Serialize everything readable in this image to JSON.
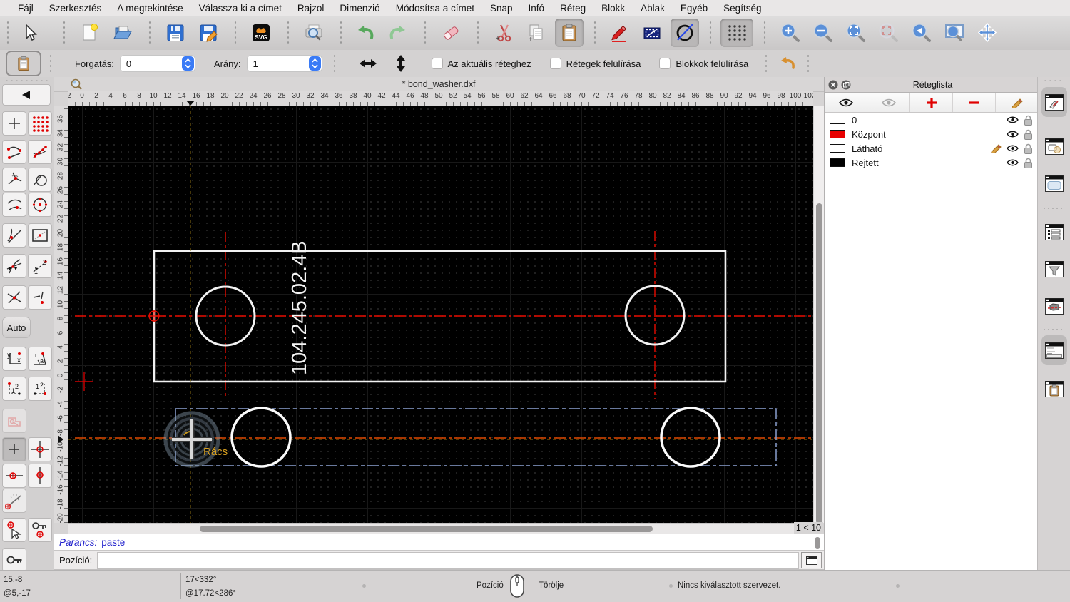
{
  "app": {
    "menu_items": [
      "Fájl",
      "Szerkesztés",
      "A megtekintése",
      "Válassza ki a címet",
      "Rajzol",
      "Dimenzió",
      "Módosítsa a címet",
      "Snap",
      "Infó",
      "Réteg",
      "Blokk",
      "Ablak",
      "Egyéb",
      "Segítség"
    ]
  },
  "main_toolbar": {
    "icons": [
      "cursor",
      "new-file",
      "open-file",
      "save",
      "save-as",
      "svg-export",
      "print-preview",
      "undo",
      "redo",
      "eraser",
      "cut",
      "copy",
      "paste",
      "draw-pencil",
      "selection-rectangle",
      "draft-circle",
      "grid-toggle",
      "zoom-in",
      "zoom-out",
      "auto-zoom",
      "zoom-selection",
      "zoom-previous",
      "zoom-window",
      "pan"
    ],
    "pressed": [
      "paste",
      "draft-circle",
      "grid-toggle"
    ]
  },
  "options_toolbar": {
    "rotation_label": "Forgatás:",
    "rotation_value": "0",
    "scale_label": "Arány:",
    "scale_value": "1",
    "checkboxes": [
      {
        "label": "Az aktuális réteghez",
        "checked": false
      },
      {
        "label": "Rétegek felülírása",
        "checked": false
      },
      {
        "label": "Blokkok felülírása",
        "checked": false
      }
    ]
  },
  "snap_toolbar": {
    "auto_label": "Auto"
  },
  "document": {
    "title": "* bond_washer.dxf",
    "zoom_state": "1 < 10",
    "part_label": "104.245.02.4B",
    "snap_label": "Rács",
    "h_ruler": {
      "start": -2,
      "end": 102,
      "step": 2
    },
    "v_ruler": {
      "start": 36,
      "end": -20,
      "step": -2
    }
  },
  "layer_panel": {
    "title": "Réteglista",
    "layers": [
      {
        "name": "0",
        "swatch": "#ffffff",
        "editing": false
      },
      {
        "name": "Központ",
        "swatch": "#e80000",
        "editing": false
      },
      {
        "name": "Látható",
        "swatch": "#ffffff",
        "editing": true
      },
      {
        "name": "Rejtett",
        "swatch": "#000000",
        "editing": false
      }
    ]
  },
  "command_area": {
    "history_label": "Parancs:",
    "history_value": "paste",
    "input_label": "Pozíció:",
    "input_value": ""
  },
  "status_bar": {
    "coord_abs": "15,-8",
    "coord_rel": "@5,-17",
    "polar_abs": "17<332°",
    "polar_rel": "@17.72<286°",
    "mouse_left_label": "Pozíció",
    "mouse_right_label": "Törölje",
    "selection_info": "Nincs kiválasztott szervezet."
  },
  "colors": {
    "canvas_bg": "#000000",
    "centerline_red": "#e80c00",
    "selection_blue": "#8aa0cf",
    "guide_yellow": "#8a6d10",
    "snap_text_orange": "#d8a020",
    "layer_red": "#e80000"
  }
}
